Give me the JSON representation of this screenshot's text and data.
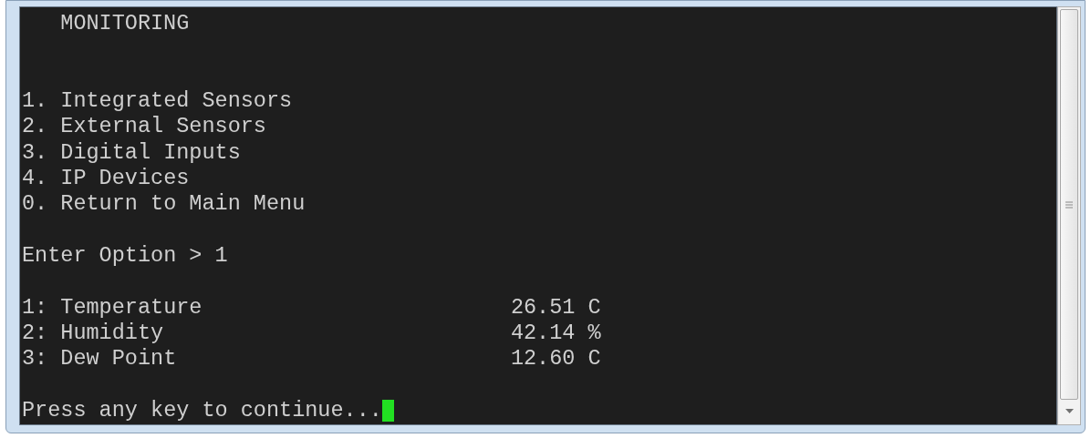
{
  "terminal": {
    "title": "MONITORING",
    "menu": [
      {
        "label": "1. Integrated Sensors"
      },
      {
        "label": "2. External Sensors"
      },
      {
        "label": "3. Digital Inputs"
      },
      {
        "label": "4. IP Devices"
      },
      {
        "label": "0. Return to Main Menu"
      }
    ],
    "prompt": "Enter Option > 1",
    "readings": [
      {
        "label": "1: Temperature",
        "value": "26.51 C"
      },
      {
        "label": "2: Humidity",
        "value": "42.14 %"
      },
      {
        "label": "3: Dew Point",
        "value": "12.60 C"
      }
    ],
    "footer": "Press any key to continue..."
  }
}
